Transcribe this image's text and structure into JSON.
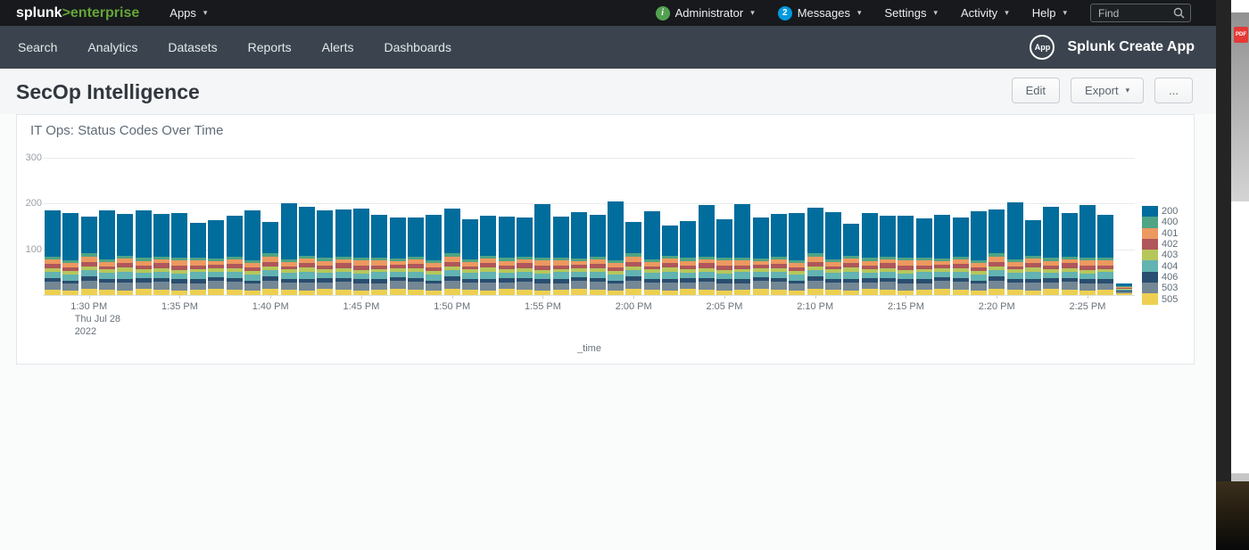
{
  "icons": {
    "caret_down": "▾"
  },
  "topbar": {
    "logo_splunk": "splunk",
    "logo_gt": ">",
    "logo_enterprise": "enterprise",
    "apps_menu": "Apps",
    "info_glyph": "i",
    "user_menu": "Administrator",
    "messages_count": "2",
    "messages_menu": "Messages",
    "settings_menu": "Settings",
    "activity_menu": "Activity",
    "help_menu": "Help",
    "find_placeholder": "Find"
  },
  "appbar": {
    "items": [
      "Search",
      "Analytics",
      "Datasets",
      "Reports",
      "Alerts",
      "Dashboards"
    ],
    "app_icon_label": "App",
    "app_name": "Splunk Create App"
  },
  "page": {
    "title": "SecOp Intelligence",
    "edit_button": "Edit",
    "export_button": "Export",
    "more_button": "..."
  },
  "panel": {
    "title": "IT Ops: Status Codes Over Time"
  },
  "background_window": {
    "pdf_badge": "PDF"
  },
  "chart_data": {
    "type": "bar",
    "stacked": true,
    "title": "IT Ops: Status Codes Over Time",
    "xlabel": "_time",
    "ylabel": "",
    "ylim": [
      0,
      300
    ],
    "yticks": [
      100,
      200,
      300
    ],
    "grid": "horizontal",
    "legend_position": "right",
    "x_interval": "1 minute",
    "x_date_sublabel": [
      "Thu Jul 28",
      "2022"
    ],
    "x_tick_labels": [
      "1:30 PM",
      "1:35 PM",
      "1:40 PM",
      "1:45 PM",
      "1:50 PM",
      "1:55 PM",
      "2:00 PM",
      "2:05 PM",
      "2:10 PM",
      "2:15 PM",
      "2:20 PM",
      "2:25 PM"
    ],
    "x_tick_indices": [
      2,
      7,
      12,
      17,
      22,
      27,
      32,
      37,
      42,
      47,
      52,
      57
    ],
    "categories": [
      "1:28 PM",
      "1:29 PM",
      "1:30 PM",
      "1:31 PM",
      "1:32 PM",
      "1:33 PM",
      "1:34 PM",
      "1:35 PM",
      "1:36 PM",
      "1:37 PM",
      "1:38 PM",
      "1:39 PM",
      "1:40 PM",
      "1:41 PM",
      "1:42 PM",
      "1:43 PM",
      "1:44 PM",
      "1:45 PM",
      "1:46 PM",
      "1:47 PM",
      "1:48 PM",
      "1:49 PM",
      "1:50 PM",
      "1:51 PM",
      "1:52 PM",
      "1:53 PM",
      "1:54 PM",
      "1:55 PM",
      "1:56 PM",
      "1:57 PM",
      "1:58 PM",
      "1:59 PM",
      "2:00 PM",
      "2:01 PM",
      "2:02 PM",
      "2:03 PM",
      "2:04 PM",
      "2:05 PM",
      "2:06 PM",
      "2:07 PM",
      "2:08 PM",
      "2:09 PM",
      "2:10 PM",
      "2:11 PM",
      "2:12 PM",
      "2:13 PM",
      "2:14 PM",
      "2:15 PM",
      "2:16 PM",
      "2:17 PM",
      "2:18 PM",
      "2:19 PM",
      "2:20 PM",
      "2:21 PM",
      "2:22 PM",
      "2:23 PM",
      "2:24 PM",
      "2:25 PM",
      "2:26 PM",
      "2:27 PM"
    ],
    "stack_order_bottom_to_top": [
      "505",
      "503",
      "406",
      "404",
      "403",
      "402",
      "401",
      "400",
      "200"
    ],
    "series": [
      {
        "name": "200",
        "color": "#006d9c",
        "values": [
          100,
          104,
          80,
          107,
          91,
          103,
          93,
          97,
          75,
          83,
          88,
          110,
          68,
          123,
          107,
          102,
          102,
          107,
          93,
          88,
          85,
          100,
          97,
          88,
          88,
          89,
          84,
          118,
          89,
          100,
          91,
          129,
          68,
          105,
          67,
          79,
          112,
          84,
          116,
          88,
          92,
          104,
          99,
          103,
          71,
          97,
          89,
          91,
          85,
          95,
          84,
          107,
          95,
          125,
          78,
          111,
          95,
          115,
          92,
          6
        ]
      },
      {
        "name": "400",
        "color": "#4fa484",
        "values": [
          6,
          5,
          7,
          6,
          5,
          8,
          6,
          5,
          7,
          6,
          6,
          5,
          7,
          6,
          5,
          8,
          6,
          5,
          7,
          6,
          6,
          5,
          7,
          6,
          5,
          8,
          6,
          5,
          7,
          6,
          6,
          5,
          7,
          6,
          5,
          8,
          6,
          5,
          7,
          6,
          6,
          5,
          7,
          6,
          5,
          8,
          6,
          5,
          7,
          6,
          6,
          5,
          7,
          6,
          5,
          8,
          6,
          5,
          7,
          1
        ]
      },
      {
        "name": "401",
        "color": "#ec9960",
        "values": [
          10,
          9,
          12,
          8,
          11,
          10,
          9,
          12,
          10,
          8,
          10,
          9,
          12,
          8,
          11,
          10,
          9,
          12,
          10,
          8,
          10,
          9,
          12,
          8,
          11,
          10,
          9,
          12,
          10,
          8,
          10,
          9,
          12,
          8,
          11,
          10,
          9,
          12,
          10,
          8,
          10,
          9,
          12,
          8,
          11,
          10,
          9,
          12,
          10,
          8,
          10,
          9,
          12,
          8,
          11,
          10,
          9,
          12,
          10,
          2
        ]
      },
      {
        "name": "402",
        "color": "#af575a",
        "values": [
          9,
          8,
          10,
          7,
          9,
          8,
          10,
          9,
          8,
          7,
          9,
          8,
          10,
          7,
          9,
          8,
          10,
          9,
          8,
          7,
          9,
          8,
          10,
          7,
          9,
          8,
          10,
          9,
          8,
          7,
          9,
          8,
          10,
          7,
          9,
          8,
          10,
          9,
          8,
          7,
          9,
          8,
          10,
          7,
          9,
          8,
          10,
          9,
          8,
          7,
          9,
          8,
          10,
          7,
          9,
          8,
          10,
          9,
          8,
          2
        ]
      },
      {
        "name": "403",
        "color": "#b6c75a",
        "values": [
          8,
          9,
          7,
          8,
          10,
          7,
          9,
          8,
          7,
          9,
          8,
          9,
          7,
          8,
          10,
          7,
          9,
          8,
          7,
          9,
          8,
          9,
          7,
          8,
          10,
          7,
          9,
          8,
          7,
          9,
          8,
          9,
          7,
          8,
          10,
          7,
          9,
          8,
          7,
          9,
          8,
          9,
          7,
          8,
          10,
          7,
          9,
          8,
          7,
          9,
          8,
          9,
          7,
          8,
          10,
          7,
          9,
          8,
          7,
          2
        ]
      },
      {
        "name": "404",
        "color": "#62b3b2",
        "values": [
          14,
          12,
          15,
          13,
          16,
          12,
          14,
          13,
          15,
          12,
          14,
          12,
          15,
          13,
          16,
          12,
          14,
          13,
          15,
          12,
          14,
          12,
          15,
          13,
          16,
          12,
          14,
          13,
          15,
          12,
          14,
          12,
          15,
          13,
          16,
          12,
          14,
          13,
          15,
          12,
          14,
          12,
          15,
          13,
          16,
          12,
          14,
          13,
          15,
          12,
          14,
          12,
          15,
          13,
          16,
          12,
          14,
          13,
          15,
          3
        ]
      },
      {
        "name": "406",
        "color": "#294e70",
        "values": [
          8,
          7,
          9,
          8,
          6,
          9,
          7,
          8,
          9,
          7,
          8,
          7,
          9,
          8,
          6,
          9,
          7,
          8,
          9,
          7,
          8,
          7,
          9,
          8,
          6,
          9,
          7,
          8,
          9,
          7,
          8,
          7,
          9,
          8,
          6,
          9,
          7,
          8,
          9,
          7,
          8,
          7,
          9,
          8,
          6,
          9,
          7,
          8,
          9,
          7,
          8,
          7,
          9,
          8,
          6,
          9,
          7,
          8,
          9,
          2
        ]
      },
      {
        "name": "503",
        "color": "#738795",
        "values": [
          17,
          15,
          18,
          16,
          19,
          14,
          17,
          16,
          15,
          18,
          17,
          15,
          18,
          16,
          19,
          14,
          17,
          16,
          15,
          18,
          17,
          15,
          18,
          16,
          19,
          14,
          17,
          16,
          15,
          18,
          17,
          15,
          18,
          16,
          19,
          14,
          17,
          16,
          15,
          18,
          17,
          15,
          18,
          16,
          19,
          14,
          17,
          16,
          15,
          18,
          17,
          15,
          18,
          16,
          19,
          14,
          17,
          16,
          15,
          4
        ]
      },
      {
        "name": "505",
        "color": "#edd051",
        "values": [
          12,
          10,
          13,
          11,
          9,
          14,
          12,
          10,
          11,
          13,
          12,
          10,
          13,
          11,
          9,
          14,
          12,
          10,
          11,
          13,
          12,
          10,
          13,
          11,
          9,
          14,
          12,
          10,
          11,
          13,
          12,
          10,
          13,
          11,
          9,
          14,
          12,
          10,
          11,
          13,
          12,
          10,
          13,
          11,
          9,
          14,
          12,
          10,
          11,
          13,
          12,
          10,
          13,
          11,
          9,
          14,
          12,
          10,
          11,
          3
        ]
      }
    ]
  }
}
